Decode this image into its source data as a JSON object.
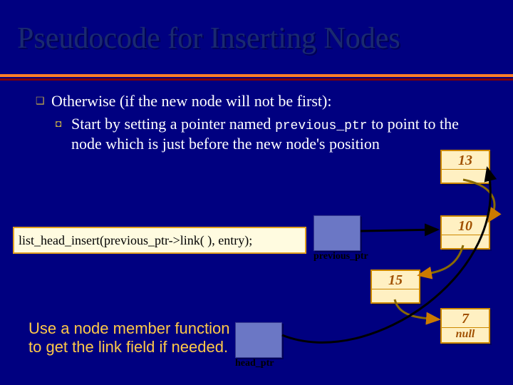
{
  "title": "Pseudocode for Inserting Nodes",
  "bullet1": "Otherwise (if the new node will not be first):",
  "bullet2_pre": "Start by setting a pointer named ",
  "bullet2_code": "previous_ptr",
  "bullet2_post": " to point to the node which is just before the new node's position",
  "code_box": "list_head_insert(previous_ptr->link( ), entry);",
  "note": "Use a node member function to get the link field if needed.",
  "ptr_previous": "previous_ptr",
  "ptr_head": "head_ptr",
  "nodes": {
    "n13": "13",
    "n10": "10",
    "n15": "15",
    "n7": "7",
    "null": "null"
  }
}
